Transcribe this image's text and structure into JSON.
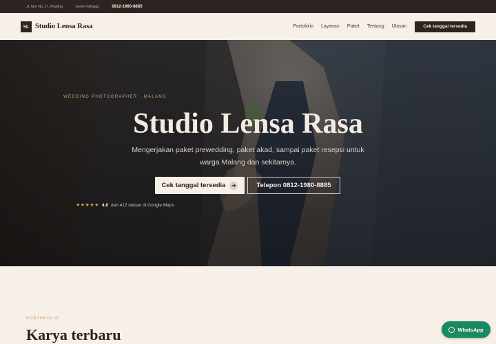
{
  "topbar": {
    "address": "Jl. Ijen No.17, Malang",
    "hours": "Senin–Minggu",
    "phone": "0812-1980-8885"
  },
  "nav": {
    "logo_initials": "SL",
    "brand": "Studio Lensa Rasa",
    "menu": [
      "Portofolio",
      "Layanan",
      "Paket",
      "Tentang",
      "Ulasan"
    ],
    "cta": "Cek tanggal tersedia"
  },
  "hero": {
    "eyebrow": "WEDDING PHOTOGRAPHER · MALANG",
    "title": "Studio Lensa Rasa",
    "subtitle": "Mengerjakan paket prewedding, paket akad, sampai paket resepsi untuk warga Malang dan sekitarnya.",
    "primary_button": "Cek tanggal tersedia",
    "secondary_button": "Telepon 0812-1980-8885",
    "rating": {
      "stars": "★★★★★",
      "score": "4.8",
      "text": "dari 412 ulasan di Google Maps"
    }
  },
  "portfolio": {
    "label": "PORTOFOLIO",
    "title": "Karya terbaru"
  },
  "whatsapp": {
    "label": "WhatsApp"
  },
  "colors": {
    "dark": "#2d2321",
    "cream": "#f7f0e9",
    "accent": "#c9a57c",
    "whatsapp": "#1a8a62"
  }
}
